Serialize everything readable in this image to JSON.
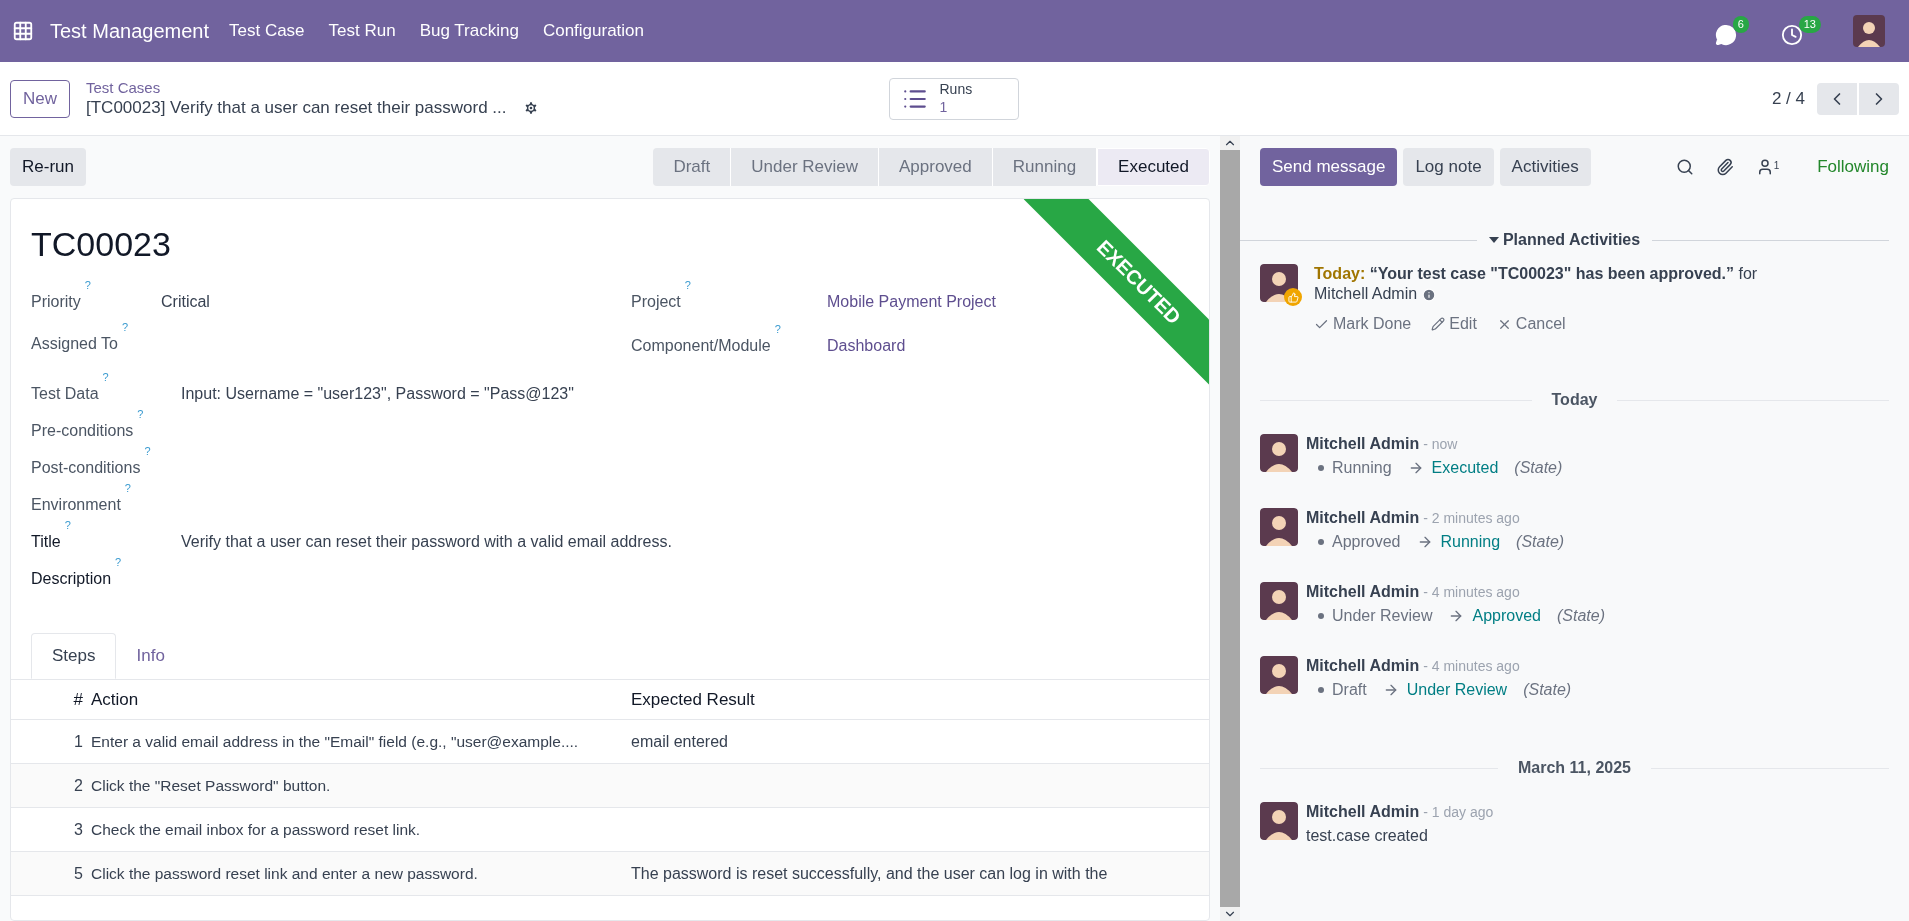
{
  "navbar": {
    "app_title": "Test Management",
    "menu": [
      "Test Case",
      "Test Run",
      "Bug Tracking",
      "Configuration"
    ],
    "messages_badge": "6",
    "activities_badge": "13"
  },
  "control_bar": {
    "new_button": "New",
    "breadcrumb_parent": "Test Cases",
    "breadcrumb_current": "[TC00023] Verify that a user can reset their password ...",
    "runs_label": "Runs",
    "runs_count": "1",
    "pager": "2 / 4"
  },
  "form": {
    "action_button": "Re-run",
    "stages": [
      {
        "label": "Draft",
        "selected": false
      },
      {
        "label": "Under Review",
        "selected": false
      },
      {
        "label": "Approved",
        "selected": false
      },
      {
        "label": "Running",
        "selected": false
      },
      {
        "label": "Executed",
        "selected": true
      }
    ],
    "ribbon": "EXECUTED",
    "reference": "TC00023",
    "left_fields": [
      {
        "label": "Priority",
        "help": "?",
        "value": "Critical"
      },
      {
        "label": "Assigned To",
        "help": "?"
      }
    ],
    "right_fields": [
      {
        "label": "Project",
        "help": "?",
        "value": "Mobile Payment Project"
      },
      {
        "label": "Component/Module",
        "help": "?",
        "value": "Dashboard"
      }
    ],
    "wide_fields": [
      {
        "label": "Test Data",
        "help": "?",
        "value": "Input: Username = \"user123\", Password = \"Pass@123\""
      },
      {
        "label": "Pre-conditions",
        "help": "?"
      },
      {
        "label": "Post-conditions",
        "help": "?"
      },
      {
        "label": "Environment",
        "help": "?"
      },
      {
        "label": "Title",
        "help": "?",
        "value": "Verify that a user can reset their password with a valid email address."
      },
      {
        "label": "Description",
        "help": "?"
      }
    ],
    "tabs": [
      {
        "label": "Steps",
        "selected": true
      },
      {
        "label": "Info",
        "selected": false
      }
    ],
    "table": {
      "columns": [
        "#",
        "Action",
        "Expected Result"
      ],
      "rows": [
        [
          "1",
          "Enter a valid email address in the \"Email\" field (e.g., \"user@example....",
          "email entered"
        ],
        [
          "2",
          "Click the \"Reset Password\" button.",
          ""
        ],
        [
          "3",
          "Check the email inbox for a password reset link.",
          ""
        ],
        [
          "5",
          "Click the password reset link and enter a new password.",
          "The password is reset successfully, and the user can log in with the"
        ]
      ]
    }
  },
  "chatter": {
    "buttons": [
      {
        "label": "Send message",
        "selected": true
      },
      {
        "label": "Log note",
        "selected": false
      },
      {
        "label": "Activities",
        "selected": false
      }
    ],
    "followers_count": "1",
    "following": "Following",
    "planned_title": "Planned Activities",
    "activity": {
      "due": "Today:",
      "summary": "“Your test case \"TC00023\" has been approved.”",
      "for_text": "for",
      "user": "Mitchell Admin",
      "actions": [
        "Mark Done",
        "Edit",
        "Cancel"
      ]
    },
    "groups": [
      {
        "date": "Today",
        "messages": [
          {
            "kind": "tracking",
            "author": "Mitchell Admin",
            "time": "- now",
            "old": "Running",
            "new": "Executed",
            "field": "(State)"
          },
          {
            "kind": "tracking",
            "author": "Mitchell Admin",
            "time": "- 2 minutes ago",
            "old": "Approved",
            "new": "Running",
            "field": "(State)"
          },
          {
            "kind": "tracking",
            "author": "Mitchell Admin",
            "time": "- 4 minutes ago",
            "old": "Under Review",
            "new": "Approved",
            "field": "(State)"
          },
          {
            "kind": "tracking",
            "author": "Mitchell Admin",
            "time": "- 4 minutes ago",
            "old": "Draft",
            "new": "Under Review",
            "field": "(State)"
          }
        ]
      },
      {
        "date": "March 11, 2025",
        "messages": [
          {
            "kind": "note",
            "author": "Mitchell Admin",
            "time": "- 1 day ago",
            "body": "test.case created"
          }
        ]
      }
    ]
  }
}
